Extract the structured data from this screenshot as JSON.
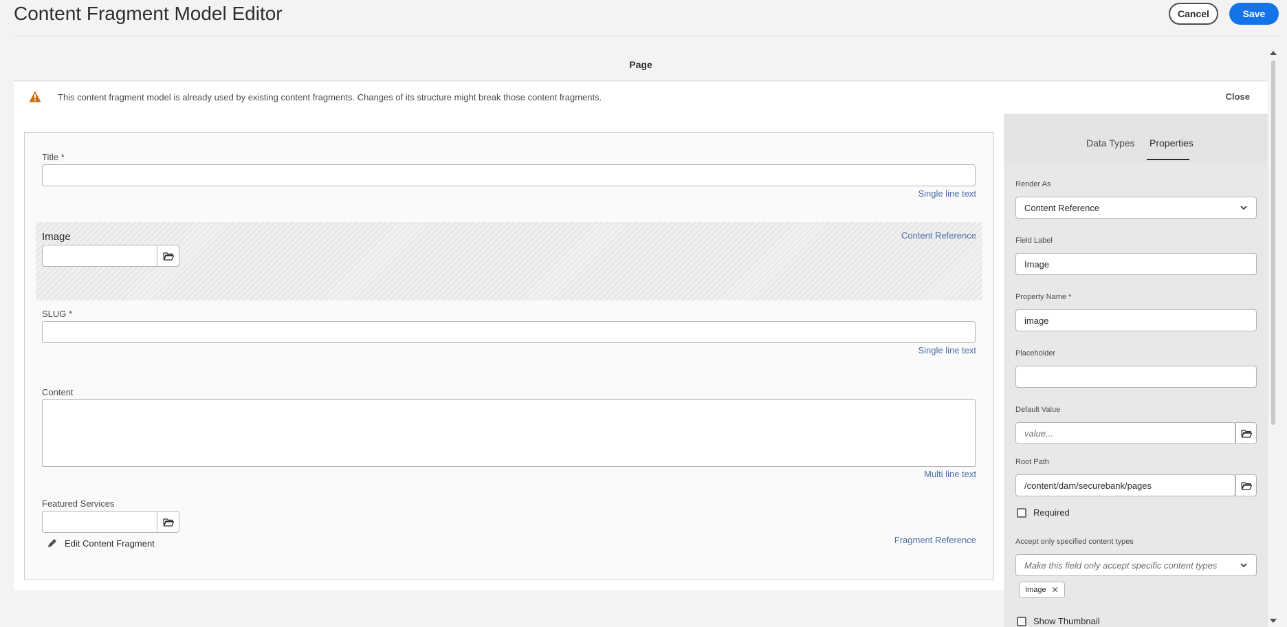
{
  "header": {
    "title": "Content Fragment Model Editor",
    "cancel_label": "Cancel",
    "save_label": "Save"
  },
  "page_bar": {
    "label": "Page"
  },
  "alert": {
    "message": "This content fragment model is already used by existing content fragments. Changes of its structure might break those content fragments.",
    "close_label": "Close"
  },
  "fields": {
    "title": {
      "label": "Title *",
      "type": "Single line text"
    },
    "image": {
      "label": "Image",
      "type": "Content Reference"
    },
    "slug": {
      "label": "SLUG *",
      "type": "Single line text"
    },
    "content": {
      "label": "Content",
      "type": "Multi line text"
    },
    "featured": {
      "label": "Featured Services",
      "type": "Fragment Reference",
      "edit_label": "Edit Content Fragment"
    }
  },
  "panel": {
    "tabs": [
      {
        "label": "Data Types"
      },
      {
        "label": "Properties"
      }
    ],
    "render_as": {
      "label": "Render As",
      "value": "Content Reference"
    },
    "field_label": {
      "label": "Field Label",
      "value": "Image"
    },
    "property_name": {
      "label": "Property Name *",
      "value": "image"
    },
    "placeholder": {
      "label": "Placeholder",
      "value": ""
    },
    "default_value": {
      "label": "Default Value",
      "placeholder": "value..."
    },
    "root_path": {
      "label": "Root Path",
      "value": "/content/dam/securebank/pages"
    },
    "required_label": "Required",
    "accept_types": {
      "label": "Accept only specified content types",
      "placeholder": "Make this field only accept specific content types"
    },
    "tag": "Image",
    "show_thumbnail_label": "Show Thumbnail"
  },
  "colors": {
    "accent": "#1473e6",
    "type_link": "#4b6fa5",
    "warning": "#e68619"
  }
}
